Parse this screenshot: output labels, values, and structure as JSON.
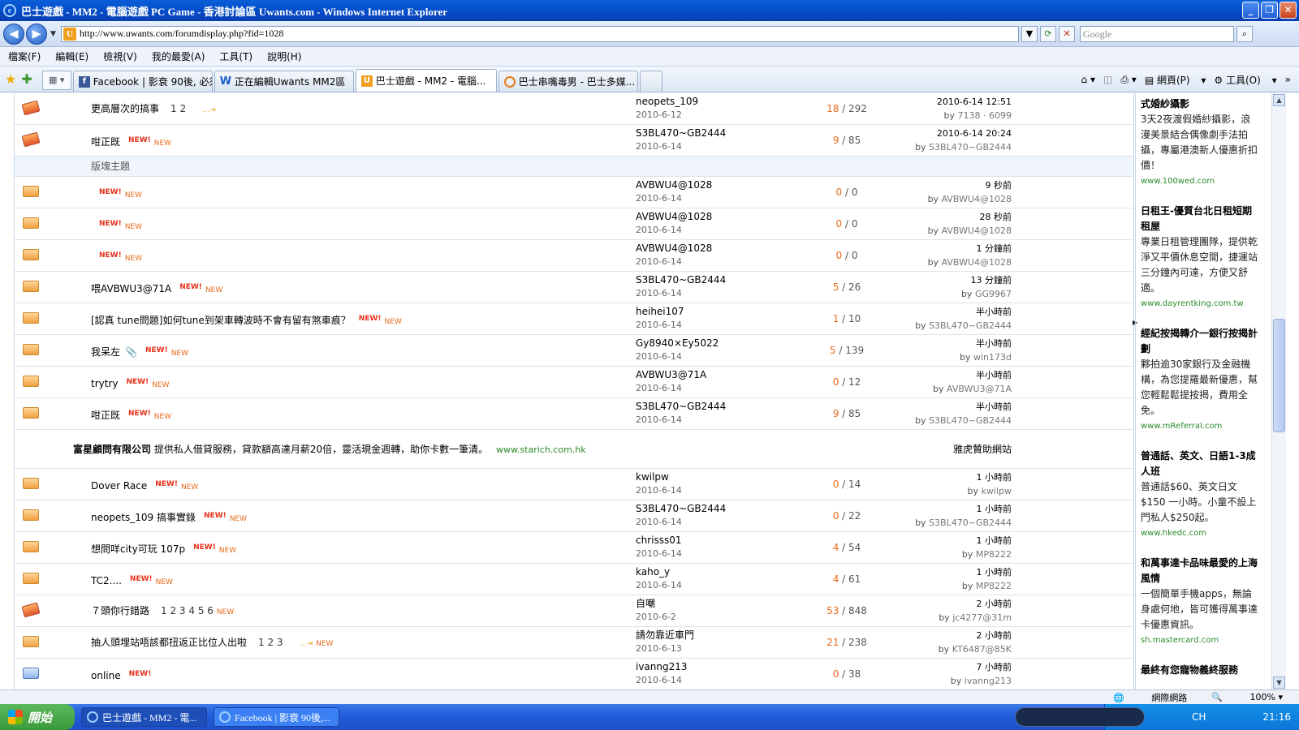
{
  "window": {
    "title": "巴士遊戲 - MM2 - 電腦遊戲 PC Game - 香港討論區 Uwants.com - Windows Internet Explorer"
  },
  "address": {
    "url": "http://www.uwants.com/forumdisplay.php?fid=1028",
    "search_placeholder": "Google"
  },
  "menu": [
    "檔案(F)",
    "編輯(E)",
    "檢視(V)",
    "我的最愛(A)",
    "工具(T)",
    "說明(H)"
  ],
  "tabs": [
    {
      "label": "Facebook | 影衰 90後, 必須...",
      "icon": "facebook-icon"
    },
    {
      "label": "正在編輯Uwants MM2區　(...",
      "icon": "uwants-icon"
    },
    {
      "label": "巴士遊戲 - MM2 - 電腦...",
      "icon": "uwants-icon"
    },
    {
      "label": "巴士串嘴毒男 - 巴士多媒...",
      "icon": "ie-icon"
    }
  ],
  "toolbar": {
    "page": "網頁(P)",
    "tools": "工具(O)"
  },
  "badges": {
    "new_a": "NEW!",
    "new_b": "NEW"
  },
  "section_label": "版塊主題",
  "top_rows": [
    {
      "icon": "hot",
      "title": "更高層次的搞事",
      "pages": "1  2",
      "author": "neopets_109",
      "date": "2010-6-12",
      "replies": "18",
      "views": "292",
      "last_time": "2010-6-14 12:51",
      "last_by": "7138 · 6099"
    },
    {
      "icon": "hot",
      "title": "咁正既",
      "pages": "",
      "author": "S3BL470~GB2444",
      "date": "2010-6-14",
      "replies": "9",
      "views": "85",
      "last_time": "2010-6-14 20:24",
      "last_by": "S3BL470~GB2444"
    }
  ],
  "rows": [
    {
      "icon": "folder",
      "title": "",
      "pages": "",
      "author": "AVBWU4@1028",
      "date": "2010-6-14",
      "replies": "0",
      "views": "0",
      "last_time": "9 秒前",
      "last_by": "AVBWU4@1028"
    },
    {
      "icon": "folder",
      "title": "",
      "pages": "",
      "author": "AVBWU4@1028",
      "date": "2010-6-14",
      "replies": "0",
      "views": "0",
      "last_time": "28 秒前",
      "last_by": "AVBWU4@1028"
    },
    {
      "icon": "folder",
      "title": "",
      "pages": "",
      "author": "AVBWU4@1028",
      "date": "2010-6-14",
      "replies": "0",
      "views": "0",
      "last_time": "1 分鐘前",
      "last_by": "AVBWU4@1028"
    },
    {
      "icon": "folder",
      "title": "喂AVBWU3@71A",
      "pages": "",
      "author": "S3BL470~GB2444",
      "date": "2010-6-14",
      "replies": "5",
      "views": "26",
      "last_time": "13 分鐘前",
      "last_by": "GG9967"
    },
    {
      "icon": "folder",
      "title": "[認真 tune問題]如何tune到架車轉波時不會有留有煞車痕？",
      "pages": "",
      "author": "heihei107",
      "date": "2010-6-14",
      "replies": "1",
      "views": "10",
      "last_time": "半小時前",
      "last_by": "S3BL470~GB2444"
    },
    {
      "icon": "folder",
      "title": "我呆左",
      "pages": "",
      "attach": true,
      "author": "Gy8940×Ey5022",
      "date": "2010-6-14",
      "replies": "5",
      "views": "139",
      "last_time": "半小時前",
      "last_by": "win173d"
    },
    {
      "icon": "folder",
      "title": "trytry",
      "pages": "",
      "author": "AVBWU3@71A",
      "date": "2010-6-14",
      "replies": "0",
      "views": "12",
      "last_time": "半小時前",
      "last_by": "AVBWU3@71A"
    },
    {
      "icon": "folder",
      "title": "咁正既",
      "pages": "",
      "author": "S3BL470~GB2444",
      "date": "2010-6-14",
      "replies": "9",
      "views": "85",
      "last_time": "半小時前",
      "last_by": "S3BL470~GB2444"
    }
  ],
  "ad": {
    "company": "富星顧問有限公司",
    "text": "提供私人借貸服務，貸款額高達月薪20倍，靈活現金週轉，助你卡數一筆清。",
    "link": "www.starich.com.hk",
    "right": "雅虎贊助網站"
  },
  "rows2": [
    {
      "icon": "folder",
      "title": "Dover Race",
      "pages": "",
      "author": "kwilpw",
      "date": "2010-6-14",
      "replies": "0",
      "views": "14",
      "last_time": "1 小時前",
      "last_by": "kwilpw"
    },
    {
      "icon": "folder",
      "title": "neopets_109 搞事實錄",
      "pages": "",
      "author": "S3BL470~GB2444",
      "date": "2010-6-14",
      "replies": "0",
      "views": "22",
      "last_time": "1 小時前",
      "last_by": "S3BL470~GB2444"
    },
    {
      "icon": "folder",
      "title": "想問咩city可玩 107p",
      "pages": "",
      "author": "chrisss01",
      "date": "2010-6-14",
      "replies": "4",
      "views": "54",
      "last_time": "1 小時前",
      "last_by": "MP8222"
    },
    {
      "icon": "folder",
      "title": "TC2....",
      "pages": "",
      "author": "kaho_y",
      "date": "2010-6-14",
      "replies": "4",
      "views": "61",
      "last_time": "1 小時前",
      "last_by": "MP8222"
    },
    {
      "icon": "hot",
      "title": "７頭你行錯路",
      "pages": "1  2  3  4  5  6",
      "author": "自嘲",
      "date": "2010-6-2",
      "replies": "53",
      "views": "848",
      "last_time": "2 小時前",
      "last_by": "jc4277@31m"
    },
    {
      "icon": "folder",
      "title": "抽人頭埋站唔該都扭返正比位人出啦",
      "pages": "1  2  3",
      "author": "請勿靠近車門",
      "date": "2010-6-13",
      "replies": "21",
      "views": "238",
      "last_time": "2 小時前",
      "last_by": "KT6487@85K"
    },
    {
      "icon": "mail",
      "title": "online",
      "pages": "",
      "author": "ivanng213",
      "date": "2010-6-14",
      "replies": "0",
      "views": "38",
      "last_time": "7 小時前",
      "last_by": "ivanng213"
    }
  ],
  "sidebar_ads": [
    {
      "h": "式婚紗攝影",
      "t": "3天2夜渡假婚紗攝影，浪漫美景結合偶像劇手法拍攝，專屬港澳新人優惠折扣價！",
      "u": "www.100wed.com"
    },
    {
      "h": "日租王-優質台北日租短期租屋",
      "t": "專業日租管理團隊，提供乾淨又平價休息空間，捷運站三分鐘內可達，方便又舒適。",
      "u": "www.dayrentking.com.tw"
    },
    {
      "h": "經紀按揭轉介一銀行按揭計劃",
      "t": "夥拍逾30家銀行及金融機構，為您提羅最新優惠，幫您輕鬆鬆提按揭，費用全免。",
      "u": "www.mReferral.com"
    },
    {
      "h": "普通話、英文、日語1-3成人班",
      "t": "普通話$60、英文日文$150 一小時。小童不設上門私人$250起。",
      "u": "www.hkedc.com"
    },
    {
      "h": "和萬事達卡品味最愛的上海風情",
      "t": "一個簡單手機apps，無論身處何地，皆可獲得萬事達卡優惠資訊。",
      "u": "sh.mastercard.com"
    },
    {
      "h": "最終有您寵物義終服務",
      "t": "",
      "u": ""
    }
  ],
  "status": {
    "zone": "網際網路",
    "zoom": "100%"
  },
  "taskbar": {
    "start": "開始",
    "tasks": [
      "巴士遊戲 - MM2 - 電...",
      "Facebook | 影衰 90後,..."
    ],
    "lang": "CH",
    "time": "21:16"
  }
}
